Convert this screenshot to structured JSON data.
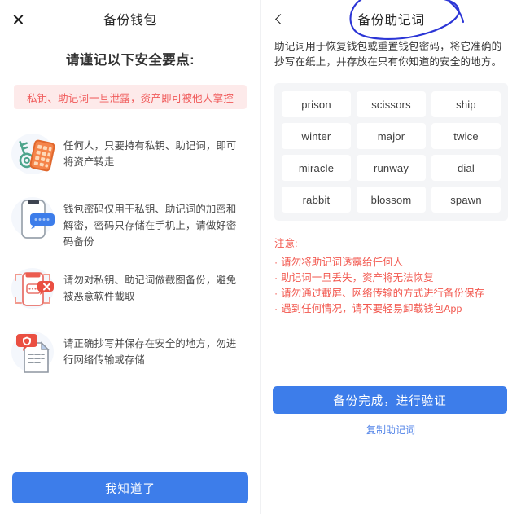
{
  "left_panel": {
    "nav": {
      "close_icon": "close-icon",
      "title": "备份钱包"
    },
    "lead_title": "请谨记以下安全要点:",
    "alert_banner": "私钥、助记词一旦泄露，资产即可被他人掌控",
    "tips": [
      {
        "icon": "key-and-keypad-icon",
        "text": "任何人，只要持有私钥、助记词，即可将资产转走"
      },
      {
        "icon": "phone-password-icon",
        "text": "钱包密码仅用于私钥、助记词的加密和解密，密码只存储在手机上，请做好密码备份"
      },
      {
        "icon": "no-screenshot-icon",
        "text": "请勿对私钥、助记词做截图备份，避免被恶意软件截取"
      },
      {
        "icon": "paper-shield-icon",
        "text": "请正确抄写并保存在安全的地方，勿进行网络传输或存储"
      }
    ],
    "primary_button": "我知道了"
  },
  "right_panel": {
    "nav": {
      "back_icon": "back-chevron-icon",
      "title": "备份助记词"
    },
    "description": "助记词用于恢复钱包或重置钱包密码，将它准确的抄写在纸上，并存放在只有你知道的安全的地方。",
    "mnemonic_words": [
      "prison",
      "scissors",
      "ship",
      "winter",
      "major",
      "twice",
      "miracle",
      "runway",
      "dial",
      "rabbit",
      "blossom",
      "spawn"
    ],
    "notes_title": "注意:",
    "notes": [
      "请勿将助记词透露给任何人",
      "助记词一旦丢失，资产将无法恢复",
      "请勿通过截屏、网络传输的方式进行备份保存",
      "遇到任何情况，请不要轻易卸载钱包App"
    ],
    "primary_button": "备份完成，进行验证",
    "copy_link": "复制助记词"
  },
  "annotation": {
    "name": "hand-drawn-circle-highlight",
    "color": "#2b35d6"
  },
  "colors": {
    "accent_blue": "#3d7dea",
    "alert_red": "#f05a5a",
    "note_red": "#f2584f",
    "banner_bg": "#fdeaea",
    "chip_bg": "#f4f5f7",
    "link_blue": "#5183e8"
  }
}
